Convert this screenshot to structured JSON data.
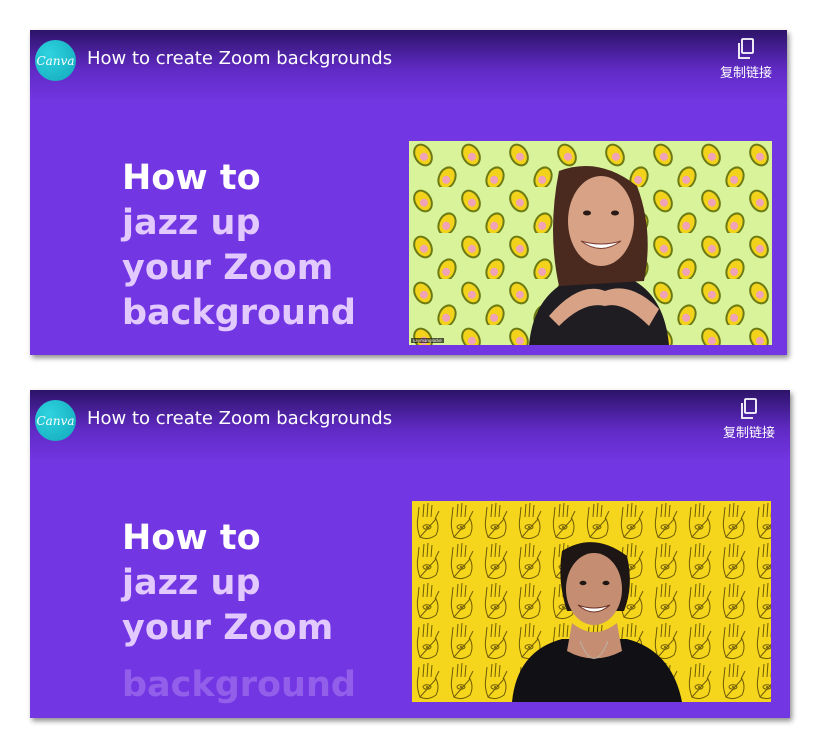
{
  "players": [
    {
      "logo_text": "Canva",
      "title": "How to create Zoom backgrounds",
      "copy_label": "复制链接",
      "headline": [
        "How to",
        "jazz up",
        "your Zoom",
        "background"
      ],
      "name_tag": "kaymanglocke",
      "background_pattern": "avocado-pattern",
      "colors": {
        "accent": "#7336e3",
        "logo": "#1ab5c6",
        "frame_bg": "#d9f39b"
      }
    },
    {
      "logo_text": "Canva",
      "title": "How to create Zoom backgrounds",
      "copy_label": "复制链接",
      "headline": [
        "How to",
        "jazz up",
        "your Zoom",
        "background"
      ],
      "background_pattern": "hamsa-hand-pattern",
      "colors": {
        "accent": "#7336e3",
        "logo": "#1ab5c6",
        "frame_bg": "#f5d61c"
      }
    }
  ]
}
